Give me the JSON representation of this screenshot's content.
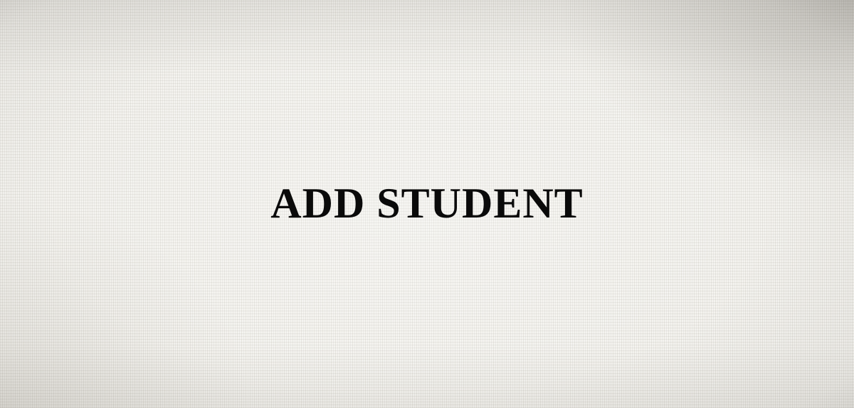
{
  "page": {
    "title": "ADD STUDENT",
    "background_color": "#f4f3ef",
    "title_color": "#0a0a0a"
  }
}
